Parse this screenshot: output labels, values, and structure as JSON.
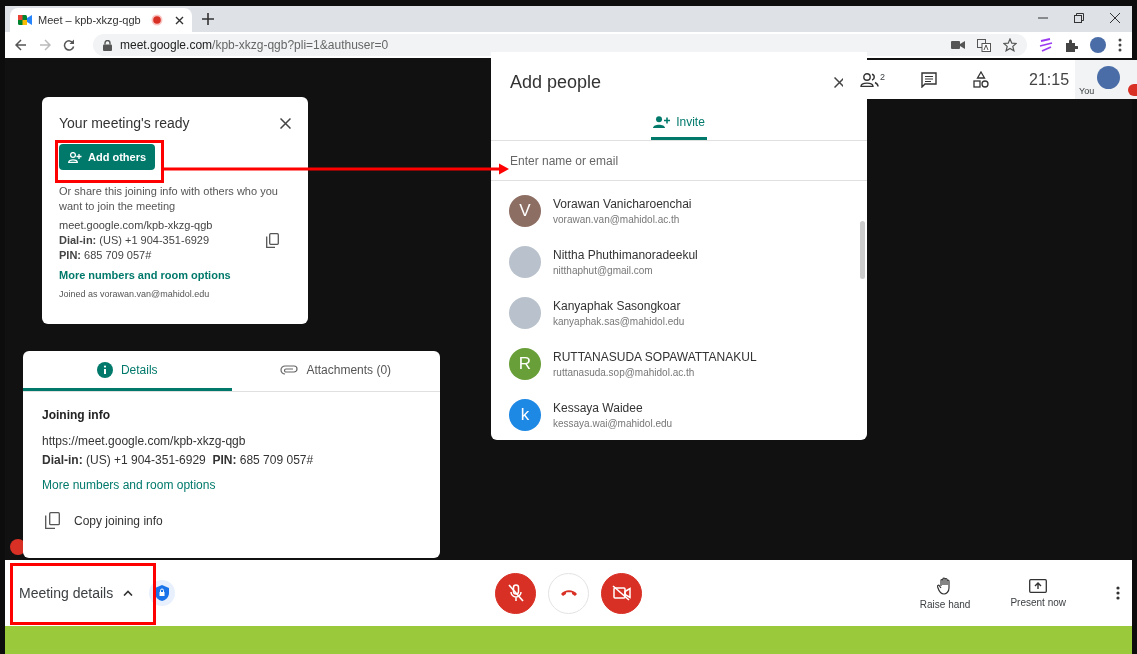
{
  "browser": {
    "tab": {
      "title": "Meet – kpb-xkzg-qgb",
      "recording": true
    },
    "url": {
      "host": "meet.google.com",
      "path": "/kpb-xkzg-qgb?pli=1&authuser=0"
    }
  },
  "ready_card": {
    "title": "Your meeting's ready",
    "add_button": "Add others",
    "share_text": "Or share this joining info with others who you want to join the meeting",
    "link": "meet.google.com/kpb-xkzg-qgb",
    "dial_in_label": "Dial-in:",
    "dial_in": "(US) +1 904-351-6929",
    "pin_label": "PIN:",
    "pin": "685 709 057#",
    "more_link": "More numbers and room options",
    "joined_as": "Joined as vorawan.van@mahidol.edu"
  },
  "details_panel": {
    "tabs": [
      {
        "label": "Details",
        "kind": "info",
        "selected": true
      },
      {
        "label": "Attachments (0)",
        "kind": "attachment",
        "selected": false
      }
    ],
    "heading": "Joining info",
    "url": "https://meet.google.com/kpb-xkzg-qgb",
    "dial_in_label": "Dial-in:",
    "dial_in": "(US) +1 904-351-6929",
    "pin_label": "PIN:",
    "pin": "685 709 057#",
    "more_link": "More numbers and room options",
    "copy_button": "Copy joining info"
  },
  "add_people": {
    "title": "Add people",
    "tabs": [
      {
        "label": "Invite",
        "selected": true
      }
    ],
    "search": {
      "placeholder": "Enter name or email"
    },
    "contacts": [
      {
        "name": "Vorawan Vanicharoenchai",
        "email": "vorawan.van@mahidol.ac.th",
        "kind": "initial",
        "initial": "V",
        "color": "#8d6e63"
      },
      {
        "name": "Nittha Phuthimanoradeekul",
        "email": "nitthaphut@gmail.com",
        "kind": "photo"
      },
      {
        "name": "Kanyaphak Sasongkoar",
        "email": "kanyaphak.sas@mahidol.edu",
        "kind": "photo"
      },
      {
        "name": "RUTTANASUDA SOPAWATTANAKUL",
        "email": "ruttanasuda.sop@mahidol.ac.th",
        "kind": "initial",
        "initial": "R",
        "color": "#689f38"
      },
      {
        "name": "Kessaya Waidee",
        "email": "kessaya.wai@mahidol.edu",
        "kind": "initial",
        "initial": "k",
        "color": "#1e88e5"
      }
    ]
  },
  "top_bar": {
    "participants_count": "2",
    "time": "21:15",
    "self_label": "You",
    "self_muted": true
  },
  "bottom_bar": {
    "meeting_details": "Meeting details",
    "tile_muted": true,
    "mic_muted": true,
    "camera_off": true,
    "raise_hand": "Raise hand",
    "present_now": "Present now"
  },
  "annotations": {
    "add_others_highlight": true,
    "arrow_to_search": true,
    "meeting_details_highlight": true
  }
}
